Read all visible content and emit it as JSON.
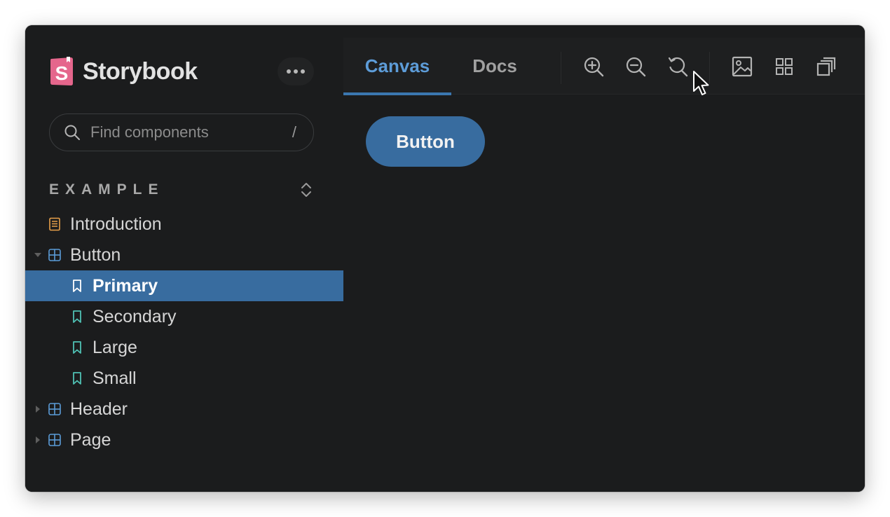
{
  "brand": {
    "name": "Storybook",
    "logo_letter": "S",
    "logo_color": "#e5668c"
  },
  "search": {
    "placeholder": "Find components",
    "shortcut": "/"
  },
  "sidebar": {
    "section_title": "EXAMPLE",
    "items": [
      {
        "label": "Introduction",
        "type": "document",
        "level": 1
      },
      {
        "label": "Button",
        "type": "component",
        "level": 1,
        "expanded": true
      },
      {
        "label": "Primary",
        "type": "story",
        "level": 2,
        "selected": true
      },
      {
        "label": "Secondary",
        "type": "story",
        "level": 2
      },
      {
        "label": "Large",
        "type": "story",
        "level": 2
      },
      {
        "label": "Small",
        "type": "story",
        "level": 2
      },
      {
        "label": "Header",
        "type": "component",
        "level": 1,
        "expanded": false
      },
      {
        "label": "Page",
        "type": "component",
        "level": 1,
        "expanded": false
      }
    ]
  },
  "toolbar": {
    "tabs": [
      {
        "label": "Canvas",
        "active": true
      },
      {
        "label": "Docs",
        "active": false
      }
    ],
    "tools": [
      "zoom-in-icon",
      "zoom-out-icon",
      "zoom-reset-icon",
      "background-image-icon",
      "grid-icon",
      "outline-icon"
    ]
  },
  "preview": {
    "button_label": "Button"
  },
  "colors": {
    "background": "#1b1c1d",
    "accent": "#386c9f",
    "active_tab": "#5d9cd8",
    "document_icon": "#e8a04a",
    "component_icon": "#5b9bd8",
    "story_icon": "#4fc1b4"
  }
}
